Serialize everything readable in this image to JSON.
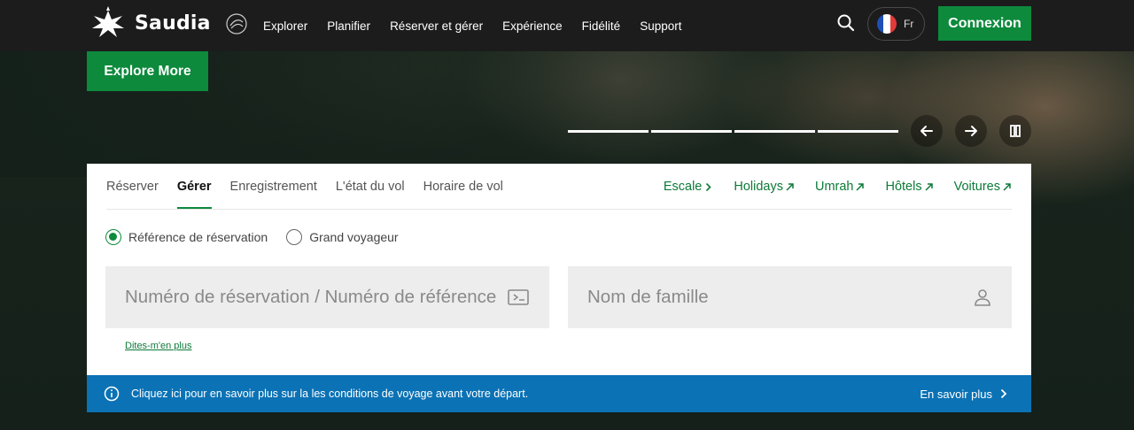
{
  "brand": {
    "name": "Saudia",
    "partner_logo": "skyteam-logo",
    "accent": "#0d8a3c"
  },
  "nav": {
    "links": [
      "Explorer",
      "Planifier",
      "Réserver et gérer",
      "Expérience",
      "Fidélité",
      "Support"
    ],
    "language": "Fr",
    "login_label": "Connexion"
  },
  "hero": {
    "explore_label": "Explore More",
    "slide_count": 4
  },
  "booking": {
    "tabs": [
      "Réserver",
      "Gérer",
      "Enregistrement",
      "L'état du vol",
      "Horaire de vol"
    ],
    "active_tab": "Gérer",
    "external_links": [
      "Escale",
      "Holidays",
      "Umrah",
      "Hôtels",
      "Voitures"
    ],
    "radios": {
      "option1": "Référence de réservation",
      "option2": "Grand voyageur",
      "selected": "Référence de réservation"
    },
    "booking_ref_placeholder": "Numéro de réservation / Numéro de référence",
    "last_name_placeholder": "Nom de famille",
    "learn_more_link": "Dites-m'en plus"
  },
  "info_bar": {
    "text": "Cliquez ici pour en savoir plus sur la les conditions de voyage avant votre départ.",
    "link": "En savoir plus",
    "color": "#0b72b5"
  }
}
